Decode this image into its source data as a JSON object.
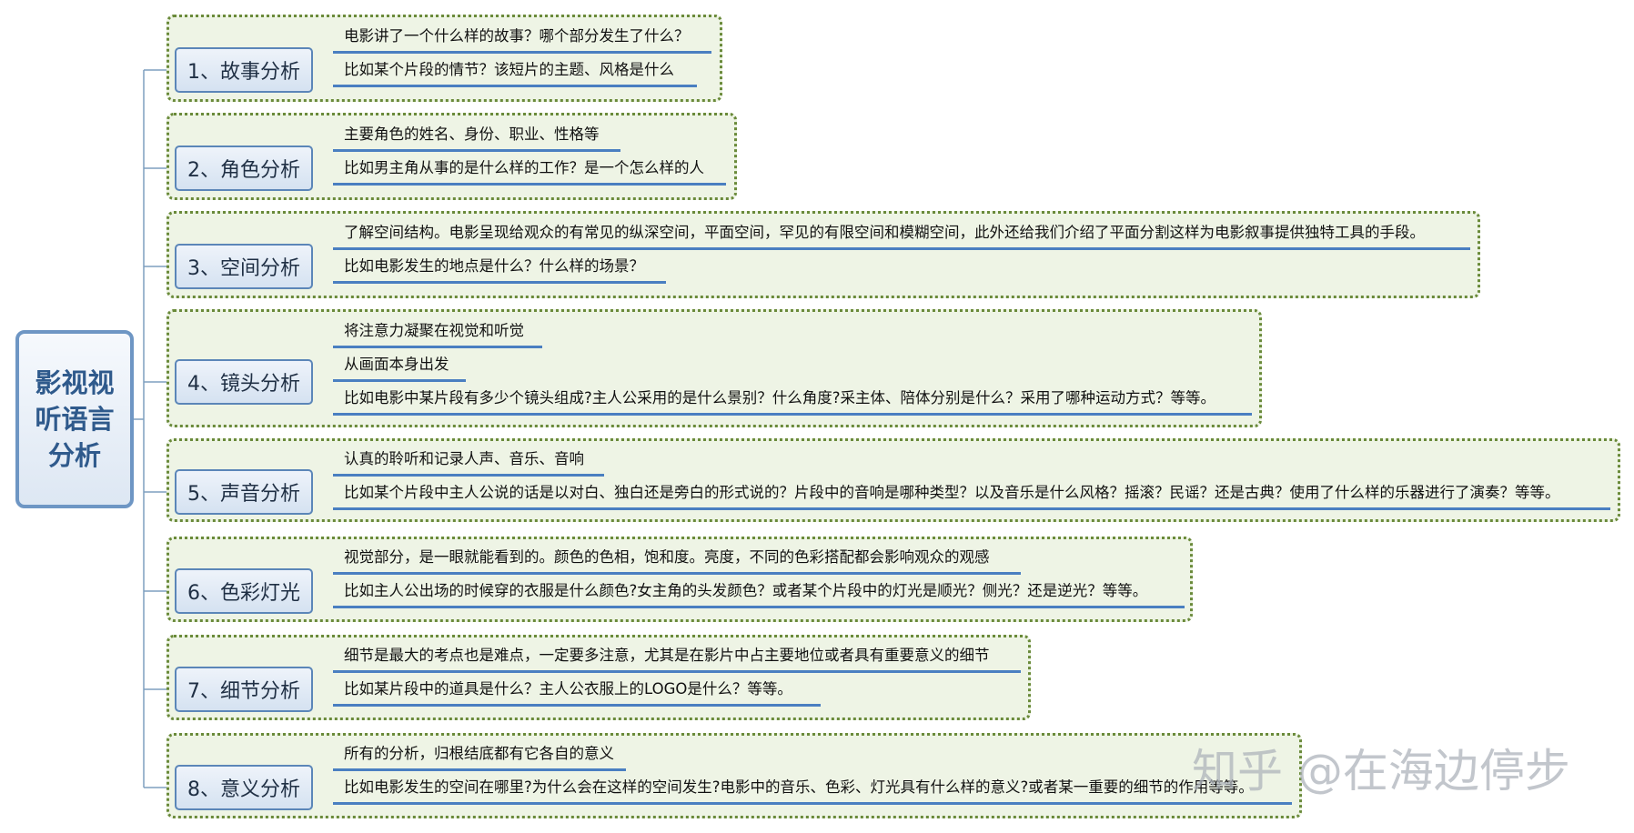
{
  "root_label": "影视视听语言分析",
  "topics": [
    {
      "label": "1、故事分析",
      "subs": [
        "电影讲了一个什么样的故事？哪个部分发生了什么？",
        "比如某个片段的情节？该短片的主题、风格是什么"
      ]
    },
    {
      "label": "2、角色分析",
      "subs": [
        "主要角色的姓名、身份、职业、性格等",
        "比如男主角从事的是什么样的工作？是一个怎么样的人"
      ]
    },
    {
      "label": "3、空间分析",
      "subs": [
        "了解空间结构。电影呈现给观众的有常见的纵深空间，平面空间，罕见的有限空间和模糊空间，此外还给我们介绍了平面分割这样为电影叙事提供独特工具的手段。",
        "比如电影发生的地点是什么？什么样的场景？"
      ]
    },
    {
      "label": "4、镜头分析",
      "subs": [
        "将注意力凝聚在视觉和听觉",
        "从画面本身出发",
        "比如电影中某片段有多少个镜头组成?主人公采用的是什么景别？什么角度?采主体、陪体分别是什么？采用了哪种运动方式？等等。"
      ]
    },
    {
      "label": "5、声音分析",
      "subs": [
        "认真的聆听和记录人声、音乐、音响",
        "比如某个片段中主人公说的话是以对白、独白还是旁白的形式说的？片段中的音响是哪种类型？以及音乐是什么风格？摇滚？民谣？还是古典？使用了什么样的乐器进行了演奏？等等。"
      ]
    },
    {
      "label": "6、色彩灯光",
      "subs": [
        "视觉部分，是一眼就能看到的。颜色的色相，饱和度。亮度，不同的色彩搭配都会影响观众的观感",
        "比如主人公出场的时候穿的衣服是什么颜色?女主角的头发颜色？或者某个片段中的灯光是顺光？侧光？还是逆光？等等。"
      ]
    },
    {
      "label": "7、细节分析",
      "subs": [
        "细节是最大的考点也是难点，一定要多注意，尤其是在影片中占主要地位或者具有重要意义的细节",
        "比如某片段中的道具是什么？主人公衣服上的LOGO是什么？等等。"
      ]
    },
    {
      "label": "8、意义分析",
      "subs": [
        "所有的分析，归根结底都有它各自的意义",
        "比如电影发生的空间在哪里?为什么会在这样的空间发生?电影中的音乐、色彩、灯光具有什么样的意义?或者某一重要的细节的作用等等。"
      ]
    }
  ],
  "watermark": "知乎 @在海边停步",
  "colors": {
    "topic_border": "#5b86b8",
    "group_border": "#6a8a3a",
    "group_fill": "#eef4e5",
    "underline": "#4a7fc1",
    "root_border": "#6e96c4"
  }
}
